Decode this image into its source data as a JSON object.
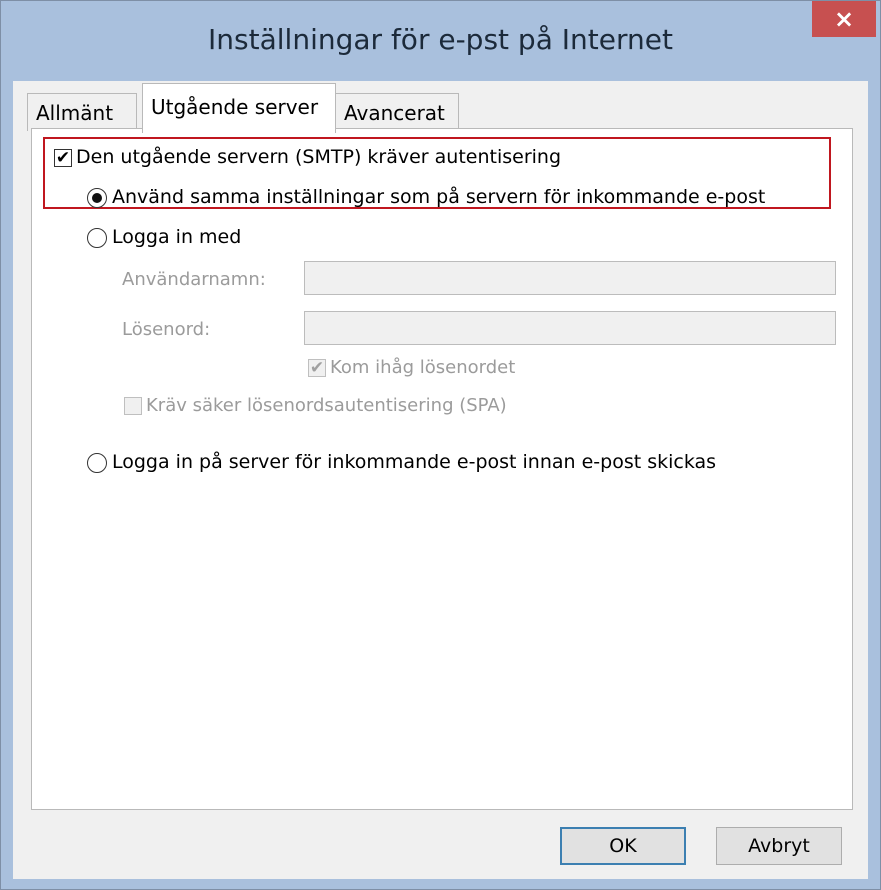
{
  "window": {
    "title": "Inställningar för e-pst på Internet",
    "close_glyph": "×",
    "accent": "#a9c0dd",
    "close_color": "#c75050"
  },
  "tabs": [
    {
      "label": "Allmänt",
      "selected": false
    },
    {
      "label": "Utgående server",
      "selected": true
    },
    {
      "label": "Avancerat",
      "selected": false
    }
  ],
  "auth": {
    "require_label": "Den utgående servern (SMTP) kräver autentisering",
    "require_checked": true,
    "same_settings_label": "Använd samma inställningar som på servern för inkommande e-post",
    "same_settings_selected": true,
    "login_with_label": "Logga in med",
    "login_with_selected": false,
    "username_label": "Användarnamn:",
    "username_value": "",
    "password_label": "Lösenord:",
    "password_value": "",
    "remember_label": "Kom ihåg lösenordet",
    "remember_checked": true,
    "spa_label": "Kräv säker lösenordsautentisering (SPA)",
    "spa_checked": false,
    "login_incoming_label": "Logga in på server för inkommande e-post innan e-post skickas",
    "login_incoming_selected": false,
    "highlight_color": "#c0171f"
  },
  "buttons": {
    "ok": "OK",
    "cancel": "Avbryt"
  }
}
